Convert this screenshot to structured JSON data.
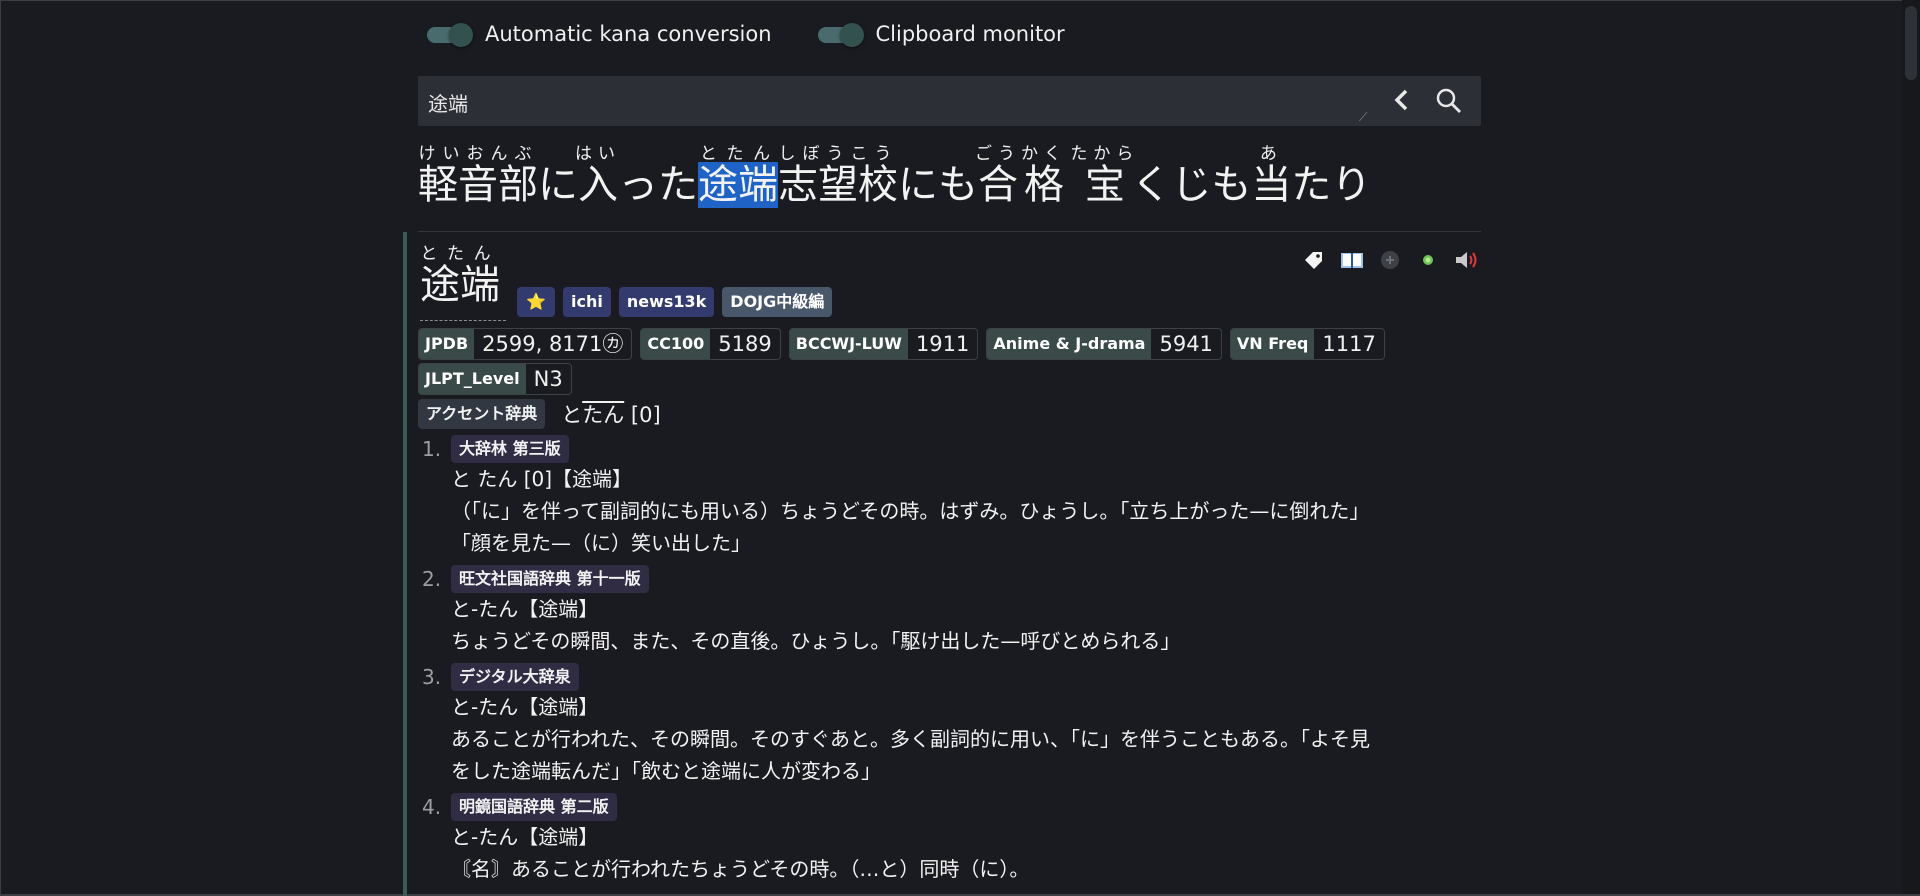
{
  "toggles": {
    "kana": "Automatic kana conversion",
    "clipboard": "Clipboard monitor"
  },
  "search": {
    "value": "途端"
  },
  "sentence": [
    {
      "kanji": "軽音部",
      "reading": "けいおんぶ",
      "highlight": false
    },
    {
      "text": "に",
      "highlight": false
    },
    {
      "kanji": "入",
      "reading": "はい",
      "highlight": false
    },
    {
      "text": "った",
      "highlight": false
    },
    {
      "kanji": "途端",
      "reading": "とたん",
      "highlight": true
    },
    {
      "kanji": "志望校",
      "reading": "しぼうこう",
      "highlight": false
    },
    {
      "text": "にも",
      "highlight": false
    },
    {
      "kanji": "合格",
      "reading": "ごうかく",
      "highlight": false
    },
    {
      "text": " ",
      "highlight": false
    },
    {
      "kanji": "宝",
      "reading": "たから",
      "highlight": false
    },
    {
      "text": "くじも",
      "highlight": false
    },
    {
      "kanji": "当",
      "reading": "あ",
      "highlight": false
    },
    {
      "text": "たり",
      "highlight": false
    }
  ],
  "entry": {
    "headword": "途端",
    "reading": "とたん",
    "tags": [
      {
        "label": "⭐",
        "type": "star"
      },
      {
        "label": "ichi",
        "type": "normal"
      },
      {
        "label": "news13k",
        "type": "normal"
      },
      {
        "label": "DOJG中級編",
        "type": "dojg"
      }
    ],
    "frequencies": [
      {
        "label": "JPDB",
        "value": "2599, 8171㋕"
      },
      {
        "label": "CC100",
        "value": "5189"
      },
      {
        "label": "BCCWJ-LUW",
        "value": "1911"
      },
      {
        "label": "Anime & J-drama",
        "value": "5941"
      },
      {
        "label": "VN Freq",
        "value": "1117"
      }
    ],
    "jlpt": {
      "label": "JLPT_Level",
      "value": "N3"
    },
    "pitch": {
      "label": "アクセント辞典",
      "low": "と",
      "high": "たん",
      "number": "[0]"
    },
    "definitions": [
      {
        "num": "1.",
        "dict": "大辞林 第三版",
        "lines": [
          "と たん [0]【途端】",
          "（「に」を伴って副詞的にも用いる）ちょうどその時。はずみ。ひょうし。「立ち上がった—に倒れた」",
          "「顔を見た—（に）笑い出した」"
        ]
      },
      {
        "num": "2.",
        "dict": "旺文社国語辞典 第十一版",
        "lines": [
          "と-たん【途端】",
          "ちょうどその瞬間、また、その直後。ひょうし。「駆け出した—呼びとめられる」"
        ]
      },
      {
        "num": "3.",
        "dict": "デジタル大辞泉",
        "lines": [
          "と-たん【途端】",
          "あることが行われた、その瞬間。そのすぐあと。多く副詞的に用い、「に」を伴うこともある。「よそ見",
          "をした途端転んだ」「飲むと途端に人が変わる」"
        ]
      },
      {
        "num": "4.",
        "dict": "明鏡国語辞典 第二版",
        "lines": [
          "と-たん【途端】",
          "〘名〙あることが行われたちょうどその時。（…と）同時（に）。"
        ]
      }
    ]
  },
  "colors": {
    "background": "#191b20",
    "highlight": "#1f63c7",
    "tag": "#323a6e",
    "freq_label": "#3a4a49",
    "entry_border": "#3b5b56",
    "dict_tag": "#2f2c43"
  }
}
